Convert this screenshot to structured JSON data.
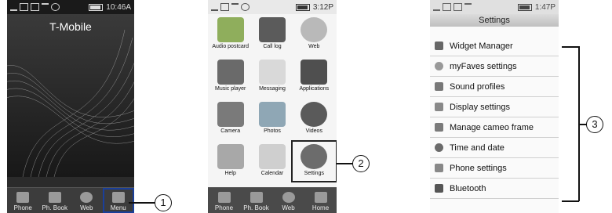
{
  "phone1": {
    "status": {
      "time": "10:46A"
    },
    "carrier": "T-Mobile",
    "softkeys": [
      {
        "label": "Phone",
        "icon": "phone-grid-icon"
      },
      {
        "label": "Ph. Book",
        "icon": "phonebook-icon"
      },
      {
        "label": "Web",
        "icon": "globe-icon"
      },
      {
        "label": "Menu",
        "icon": "menu-grid-icon"
      }
    ],
    "callout": "1"
  },
  "phone2": {
    "status": {
      "time": "3:12P"
    },
    "apps": [
      {
        "label": "Audio postcard",
        "icon": "audio-postcard-icon",
        "color": "#8fae5c"
      },
      {
        "label": "Call log",
        "icon": "call-log-icon",
        "color": "#5b5b5b"
      },
      {
        "label": "Web",
        "icon": "globe-icon",
        "color": "#b9b9b9"
      },
      {
        "label": "Music player",
        "icon": "music-player-icon",
        "color": "#6a6a6a"
      },
      {
        "label": "Messaging",
        "icon": "envelope-icon",
        "color": "#d9d9d9"
      },
      {
        "label": "Applications",
        "icon": "applications-icon",
        "color": "#4f4f4f"
      },
      {
        "label": "Camera",
        "icon": "camera-icon",
        "color": "#7a7a7a"
      },
      {
        "label": "Photos",
        "icon": "photos-icon",
        "color": "#8fa7b5"
      },
      {
        "label": "Videos",
        "icon": "film-reel-icon",
        "color": "#5a5a5a"
      },
      {
        "label": "Help",
        "icon": "help-icon",
        "color": "#a8a8a8"
      },
      {
        "label": "Calendar",
        "icon": "calendar-icon",
        "color": "#cfcfcf"
      },
      {
        "label": "Settings",
        "icon": "gear-icon",
        "color": "#6c6c6c"
      }
    ],
    "softkeys": [
      {
        "label": "Phone",
        "icon": "phone-grid-icon"
      },
      {
        "label": "Ph. Book",
        "icon": "phonebook-icon"
      },
      {
        "label": "Web",
        "icon": "globe-icon"
      },
      {
        "label": "Home",
        "icon": "home-icon"
      }
    ],
    "callout": "2"
  },
  "phone3": {
    "status": {
      "time": "1:47P"
    },
    "title": "Settings",
    "items": [
      {
        "label": "Widget Manager",
        "icon": "widget-icon"
      },
      {
        "label": "myFaves settings",
        "icon": "myfaves-icon"
      },
      {
        "label": "Sound profiles",
        "icon": "speaker-icon"
      },
      {
        "label": "Display settings",
        "icon": "display-icon"
      },
      {
        "label": "Manage cameo frame",
        "icon": "cameo-frame-icon"
      },
      {
        "label": "Time and date",
        "icon": "clock-icon"
      },
      {
        "label": "Phone settings",
        "icon": "phone-settings-icon"
      },
      {
        "label": "Bluetooth",
        "icon": "bluetooth-icon"
      }
    ],
    "callout": "3"
  }
}
